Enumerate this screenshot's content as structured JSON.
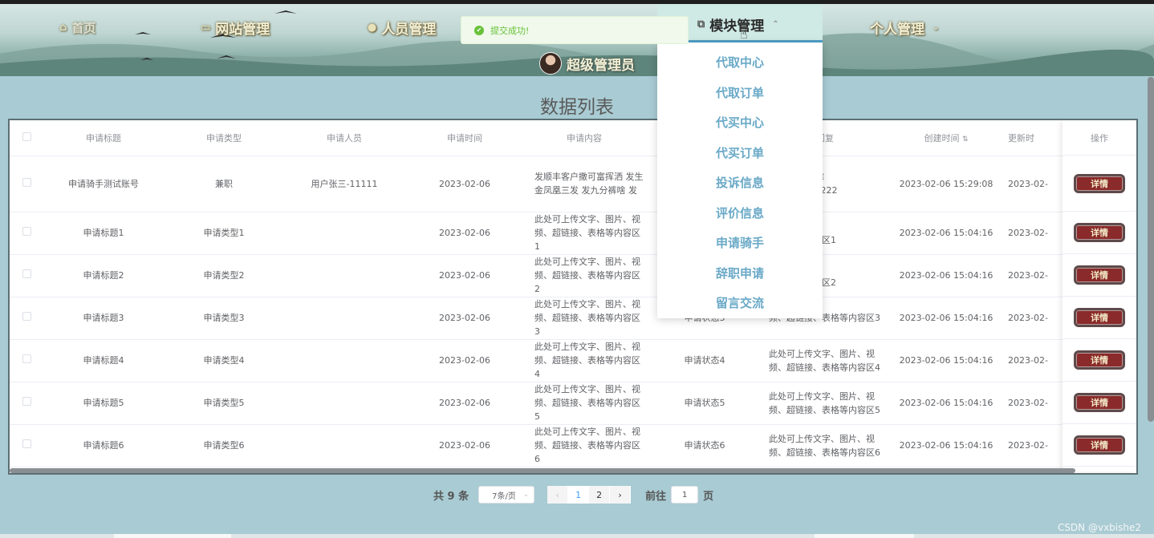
{
  "nav": {
    "home": "首页",
    "items": [
      {
        "label": "网站管理",
        "icon": "monitor-icon"
      },
      {
        "label": "人员管理",
        "icon": "person-icon"
      },
      {
        "label": "模块管理",
        "icon": "copy-icon"
      },
      {
        "label": "个人管理",
        "icon": ""
      }
    ],
    "admin_name": "超级管理员"
  },
  "toast": {
    "message": "提交成功!"
  },
  "dropdown": [
    "代取中心",
    "代取订单",
    "代买中心",
    "代买订单",
    "投诉信息",
    "评价信息",
    "申请骑手",
    "辞职申请",
    "留言交流"
  ],
  "page_title": "数据列表",
  "table": {
    "columns": [
      "申请标题",
      "申请类型",
      "申请人员",
      "申请时间",
      "申请内容",
      "",
      "请回复",
      "创建时间",
      "更新时"
    ],
    "op_header": "操作",
    "detail_label": "详情",
    "rows": [
      {
        "title": "申请骑手测试账号",
        "type": "兼职",
        "person": "用户张三-11111",
        "time": "2023-02-06",
        "content1": "发顺丰客户撒可富挥洒 发生",
        "content2": "金凤凰三发 发九分裤啥 发",
        "status": "",
        "reply1": "发送账号 代拿",
        "reply2": "2222 密码：222",
        "created": "2023-02-06 15:29:08",
        "updated": "2023-02-"
      },
      {
        "title": "申请标题1",
        "type": "申请类型1",
        "person": "",
        "time": "2023-02-06",
        "content1": "此处可上传文字、图片、视",
        "content2": "频、超链接、表格等内容区1",
        "status": "",
        "reply1": "字、图片、视",
        "reply2": "字表格等内容区1",
        "created": "2023-02-06 15:04:16",
        "updated": "2023-02-"
      },
      {
        "title": "申请标题2",
        "type": "申请类型2",
        "person": "",
        "time": "2023-02-06",
        "content1": "此处可上传文字、图片、视",
        "content2": "频、超链接、表格等内容区2",
        "status": "",
        "reply1": "字、图片、视",
        "reply2": "字表格等内容区2",
        "created": "2023-02-06 15:04:16",
        "updated": "2023-02-"
      },
      {
        "title": "申请标题3",
        "type": "申请类型3",
        "person": "",
        "time": "2023-02-06",
        "content1": "此处可上传文字、图片、视",
        "content2": "频、超链接、表格等内容区3",
        "status": "申请状态3",
        "reply1": "",
        "reply2": "频、超链接、表格等内容区3",
        "created": "2023-02-06 15:04:16",
        "updated": "2023-02-"
      },
      {
        "title": "申请标题4",
        "type": "申请类型4",
        "person": "",
        "time": "2023-02-06",
        "content1": "此处可上传文字、图片、视",
        "content2": "频、超链接、表格等内容区4",
        "status": "申请状态4",
        "reply1": "此处可上传文字、图片、视",
        "reply2": "频、超链接、表格等内容区4",
        "created": "2023-02-06 15:04:16",
        "updated": "2023-02-"
      },
      {
        "title": "申请标题5",
        "type": "申请类型5",
        "person": "",
        "time": "2023-02-06",
        "content1": "此处可上传文字、图片、视",
        "content2": "频、超链接、表格等内容区5",
        "status": "申请状态5",
        "reply1": "此处可上传文字、图片、视",
        "reply2": "频、超链接、表格等内容区5",
        "created": "2023-02-06 15:04:16",
        "updated": "2023-02-"
      },
      {
        "title": "申请标题6",
        "type": "申请类型6",
        "person": "",
        "time": "2023-02-06",
        "content1": "此处可上传文字、图片、视",
        "content2": "频、超链接、表格等内容区6",
        "status": "申请状态6",
        "reply1": "此处可上传文字、图片、视",
        "reply2": "频、超链接、表格等内容区6",
        "created": "2023-02-06 15:04:16",
        "updated": "2023-02-"
      }
    ]
  },
  "pager": {
    "total": "共 9 条",
    "page_size": "7条/页",
    "pages": [
      "1",
      "2"
    ],
    "current": "1",
    "goto": "前往",
    "goto_value": "1",
    "page_unit": "页",
    "prev": "‹",
    "next": "›"
  },
  "watermark": "CSDN @vxbishe2"
}
